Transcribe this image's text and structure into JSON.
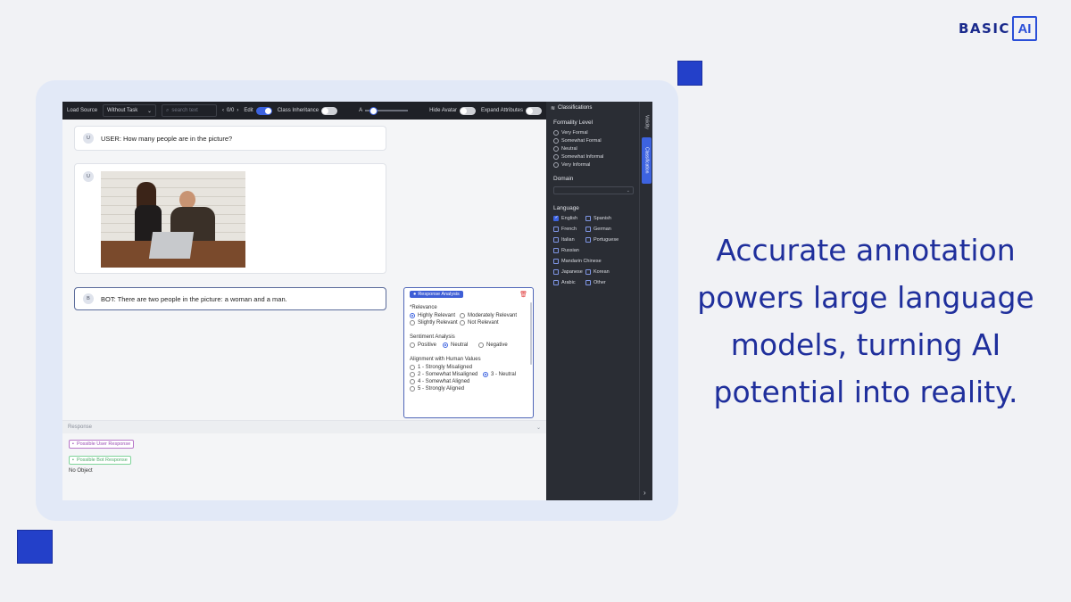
{
  "brand": {
    "name": "BASIC",
    "badge": "AI"
  },
  "toolbar": {
    "load_source_label": "Load Source",
    "load_source_value": "Without Task",
    "search_placeholder": "search text",
    "pager": "0/0",
    "edit_label": "Edit",
    "class_inheritance_label": "Class Inheritance",
    "hide_avatar_label": "Hide Avatar",
    "expand_attributes_label": "Expand Attributes"
  },
  "chat": {
    "user_avatar": "U",
    "user_message": "USER: How many people are in the picture?",
    "image_avatar": "U",
    "bot_avatar": "B",
    "bot_message": "BOT: There are two people in the picture: a woman and a man."
  },
  "response_analysis": {
    "title": "Response Analysis",
    "relevance": {
      "question": "*Relevance",
      "options": [
        "Highly Relevant",
        "Moderately Relevant",
        "Slightly Relevant",
        "Not Relevant"
      ],
      "selected": "Highly Relevant"
    },
    "sentiment": {
      "question": "Sentiment Analysis",
      "options": [
        "Positive",
        "Neutral",
        "Negative"
      ],
      "selected": "Neutral"
    },
    "alignment": {
      "question": "Alignment with Human Values",
      "options": [
        "1 - Strongly Misaligned",
        "2 - Somewhat Misaligned",
        "3 - Neutral",
        "4 - Somewhat Aligned",
        "5 - Strongly Aligned"
      ],
      "selected": "3 - Neutral"
    }
  },
  "response_panel": {
    "title": "Response",
    "possible_user": "Possible User Response",
    "possible_bot": "Possible Bot Response",
    "no_object": "No Object"
  },
  "classifications": {
    "title": "Classifications",
    "formality": {
      "label": "Formality Level",
      "options": [
        "Very Formal",
        "Somewhat Formal",
        "Neutral",
        "Somewhat Informal",
        "Very Informal"
      ]
    },
    "domain_label": "Domain",
    "language": {
      "label": "Language",
      "options": [
        "English",
        "Spanish",
        "French",
        "German",
        "Italian",
        "Portuguese",
        "Russian",
        "Mandarin Chinese",
        "Japanese",
        "Korean",
        "Arabic",
        "Other"
      ],
      "checked": [
        "English"
      ]
    }
  },
  "side_tabs": {
    "validity": "Validity",
    "classification": "Classification"
  },
  "headline": {
    "line1": "Accurate annotation",
    "line2": "powers large language",
    "line3": "models, turning AI",
    "line4": "potential into reality."
  },
  "colors": {
    "accent": "#3d63e0",
    "headline": "#1f2f9c",
    "dark_panel": "#2a2d34"
  }
}
